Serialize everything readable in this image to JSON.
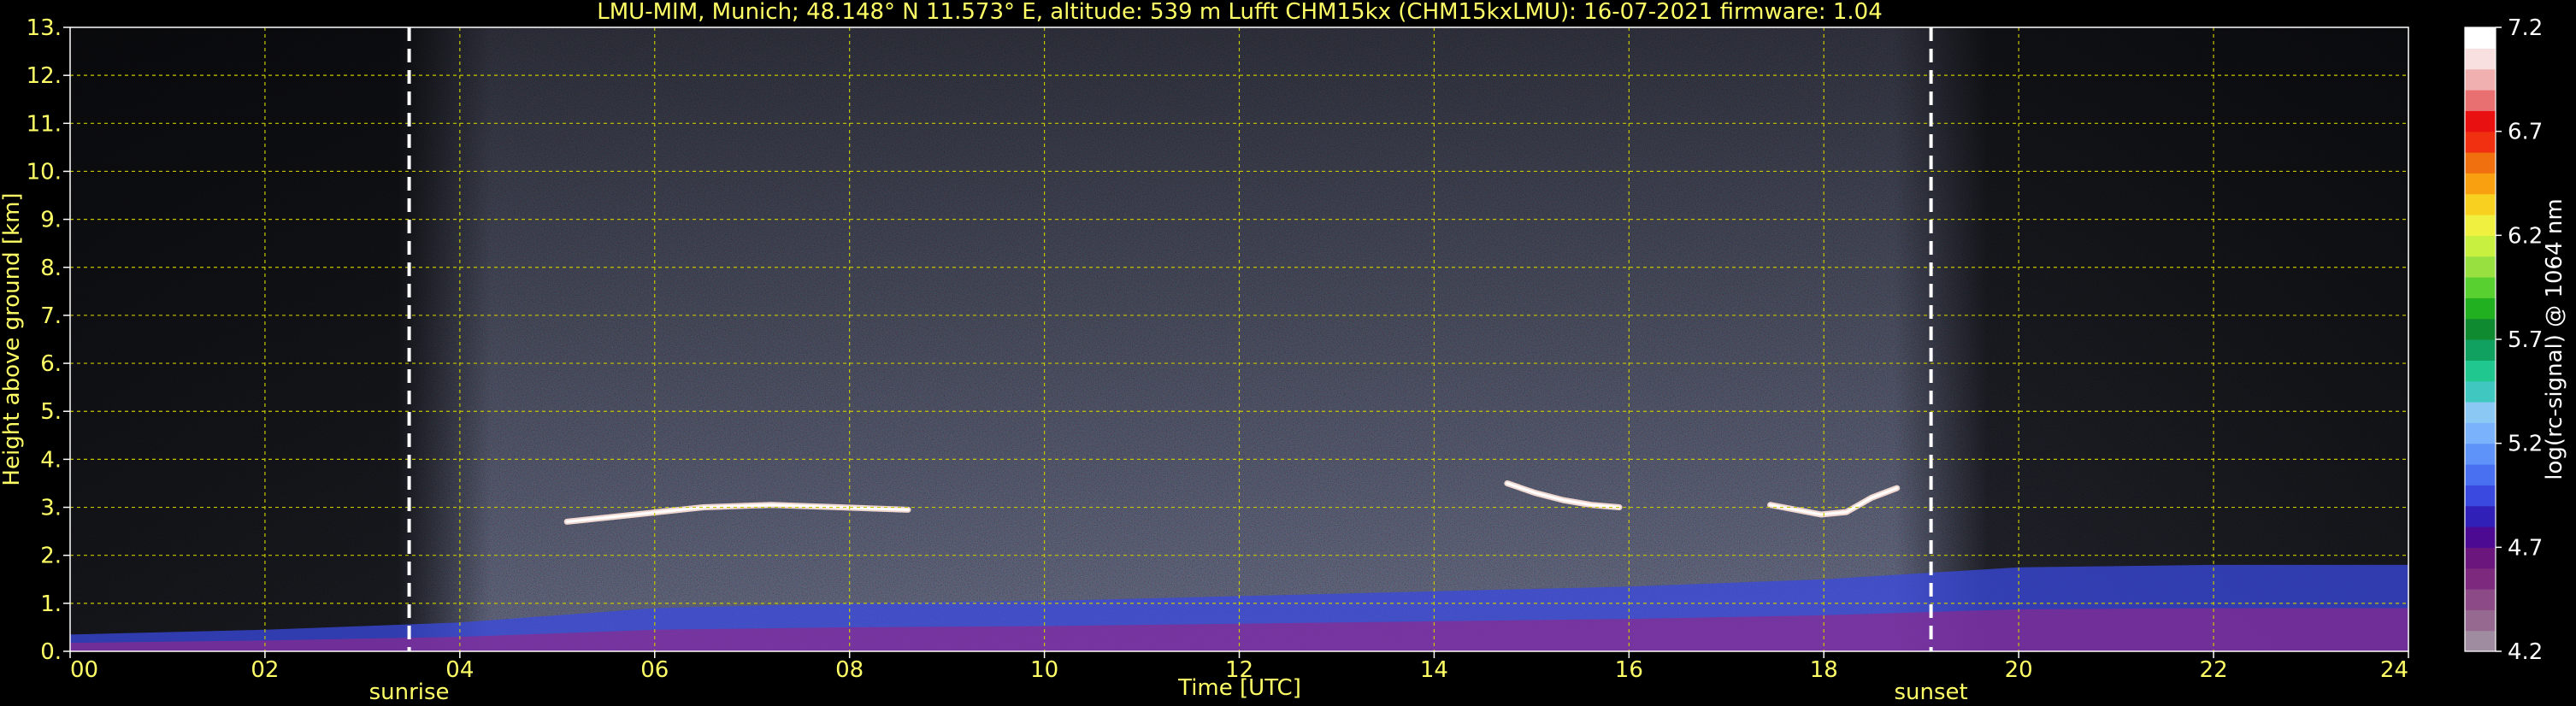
{
  "chart_data": {
    "type": "heatmap",
    "title": "LMU-MIM, Munich; 48.148° N 11.573° E, altitude: 539 m    Lufft CHM15kx (CHM15kxLMU): 16-07-2021    firmware: 1.04",
    "xlabel": "Time [UTC]",
    "ylabel": "Height above ground [km]",
    "xlim": [
      0,
      24
    ],
    "ylim": [
      0,
      13
    ],
    "x_ticks": [
      "00",
      "02",
      "04",
      "06",
      "08",
      "10",
      "12",
      "14",
      "16",
      "18",
      "20",
      "22",
      "24"
    ],
    "y_ticks": [
      "0.",
      "1.",
      "2.",
      "3.",
      "4.",
      "5.",
      "6.",
      "7.",
      "8.",
      "9.",
      "10.",
      "11.",
      "12.",
      "13."
    ],
    "grid": true,
    "colorbar": {
      "label": "log(rc-signal) @ 1064 nm",
      "min": 4.2,
      "max": 7.2,
      "ticks": [
        "4.2",
        "4.7",
        "5.2",
        "5.7",
        "6.2",
        "6.7",
        "7.2"
      ],
      "colors": [
        "#a08ca0",
        "#966a90",
        "#8c4a86",
        "#7d2a7e",
        "#6a167d",
        "#4c0a92",
        "#3020b8",
        "#3a4ae0",
        "#4a70f2",
        "#5e94fa",
        "#7ab2fc",
        "#8cc8f4",
        "#40c8c0",
        "#20c890",
        "#10a060",
        "#108a30",
        "#20b020",
        "#58d030",
        "#98e040",
        "#c8f040",
        "#f0f040",
        "#f8d020",
        "#f8a010",
        "#f07010",
        "#f03010",
        "#e81010",
        "#e87070",
        "#f0b0b0",
        "#f8e0e0",
        "#ffffff"
      ]
    },
    "markers": [
      {
        "label": "sunrise",
        "x": 3.48
      },
      {
        "label": "sunset",
        "x": 19.1
      }
    ],
    "cloud_layers": [
      {
        "x_start": 5.1,
        "x_end": 8.6,
        "height": [
          2.7,
          2.85,
          3.0,
          3.05,
          3.0,
          2.95
        ]
      },
      {
        "x_start": 14.75,
        "x_end": 15.9,
        "height": [
          3.5,
          3.3,
          3.15,
          3.05,
          3.0
        ]
      },
      {
        "x_start": 17.45,
        "x_end": 18.75,
        "height": [
          3.05,
          2.95,
          2.85,
          2.9,
          3.2,
          3.4
        ]
      }
    ],
    "aerosol_top": [
      {
        "x": 0,
        "height": 0.35
      },
      {
        "x": 2,
        "height": 0.45
      },
      {
        "x": 4,
        "height": 0.6
      },
      {
        "x": 6,
        "height": 0.9
      },
      {
        "x": 8,
        "height": 1.0
      },
      {
        "x": 10,
        "height": 1.05
      },
      {
        "x": 12,
        "height": 1.15
      },
      {
        "x": 14,
        "height": 1.25
      },
      {
        "x": 16,
        "height": 1.35
      },
      {
        "x": 18,
        "height": 1.5
      },
      {
        "x": 20,
        "height": 1.75
      },
      {
        "x": 22,
        "height": 1.8
      },
      {
        "x": 24,
        "height": 1.8
      }
    ]
  }
}
